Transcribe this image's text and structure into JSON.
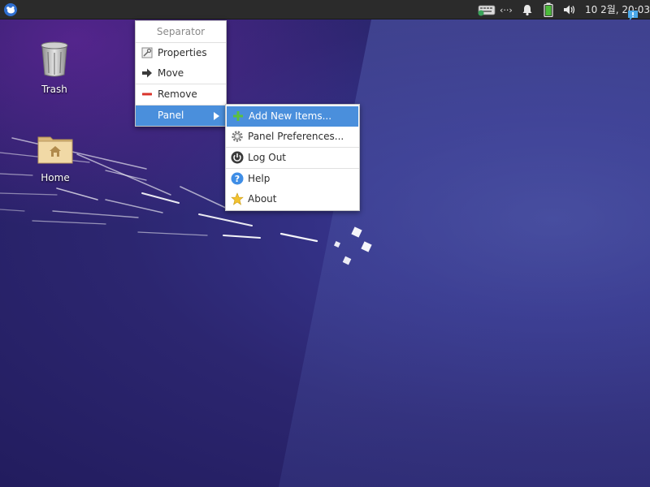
{
  "desktop": {
    "icons": [
      {
        "label": "Trash"
      },
      {
        "label": "Home"
      }
    ]
  },
  "panel": {
    "clock": "10 2월, 20:03",
    "tray_icons": [
      "keyboard-layout-icon",
      "network-icon",
      "notification-bell-icon",
      "battery-icon",
      "volume-icon"
    ]
  },
  "context_menu": {
    "header": "Separator",
    "items": [
      {
        "label": "Properties",
        "icon": "properties-icon"
      },
      {
        "label": "Move",
        "icon": "move-arrow-icon"
      },
      {
        "label": "Remove",
        "icon": "remove-icon"
      },
      {
        "label": "Panel",
        "icon": "",
        "has_submenu": true,
        "active": true
      }
    ]
  },
  "panel_submenu": {
    "items": [
      {
        "label": "Add New Items...",
        "icon": "add-icon",
        "active": true
      },
      {
        "label": "Panel Preferences...",
        "icon": "gear-icon"
      },
      {
        "label": "Log Out",
        "icon": "power-icon"
      },
      {
        "label": "Help",
        "icon": "help-icon"
      },
      {
        "label": "About",
        "icon": "star-icon"
      }
    ]
  },
  "colors": {
    "panel_bg": "#2b2b2b",
    "menu_highlight": "#4a8fdc",
    "desktop_bg": "#2c2670"
  }
}
